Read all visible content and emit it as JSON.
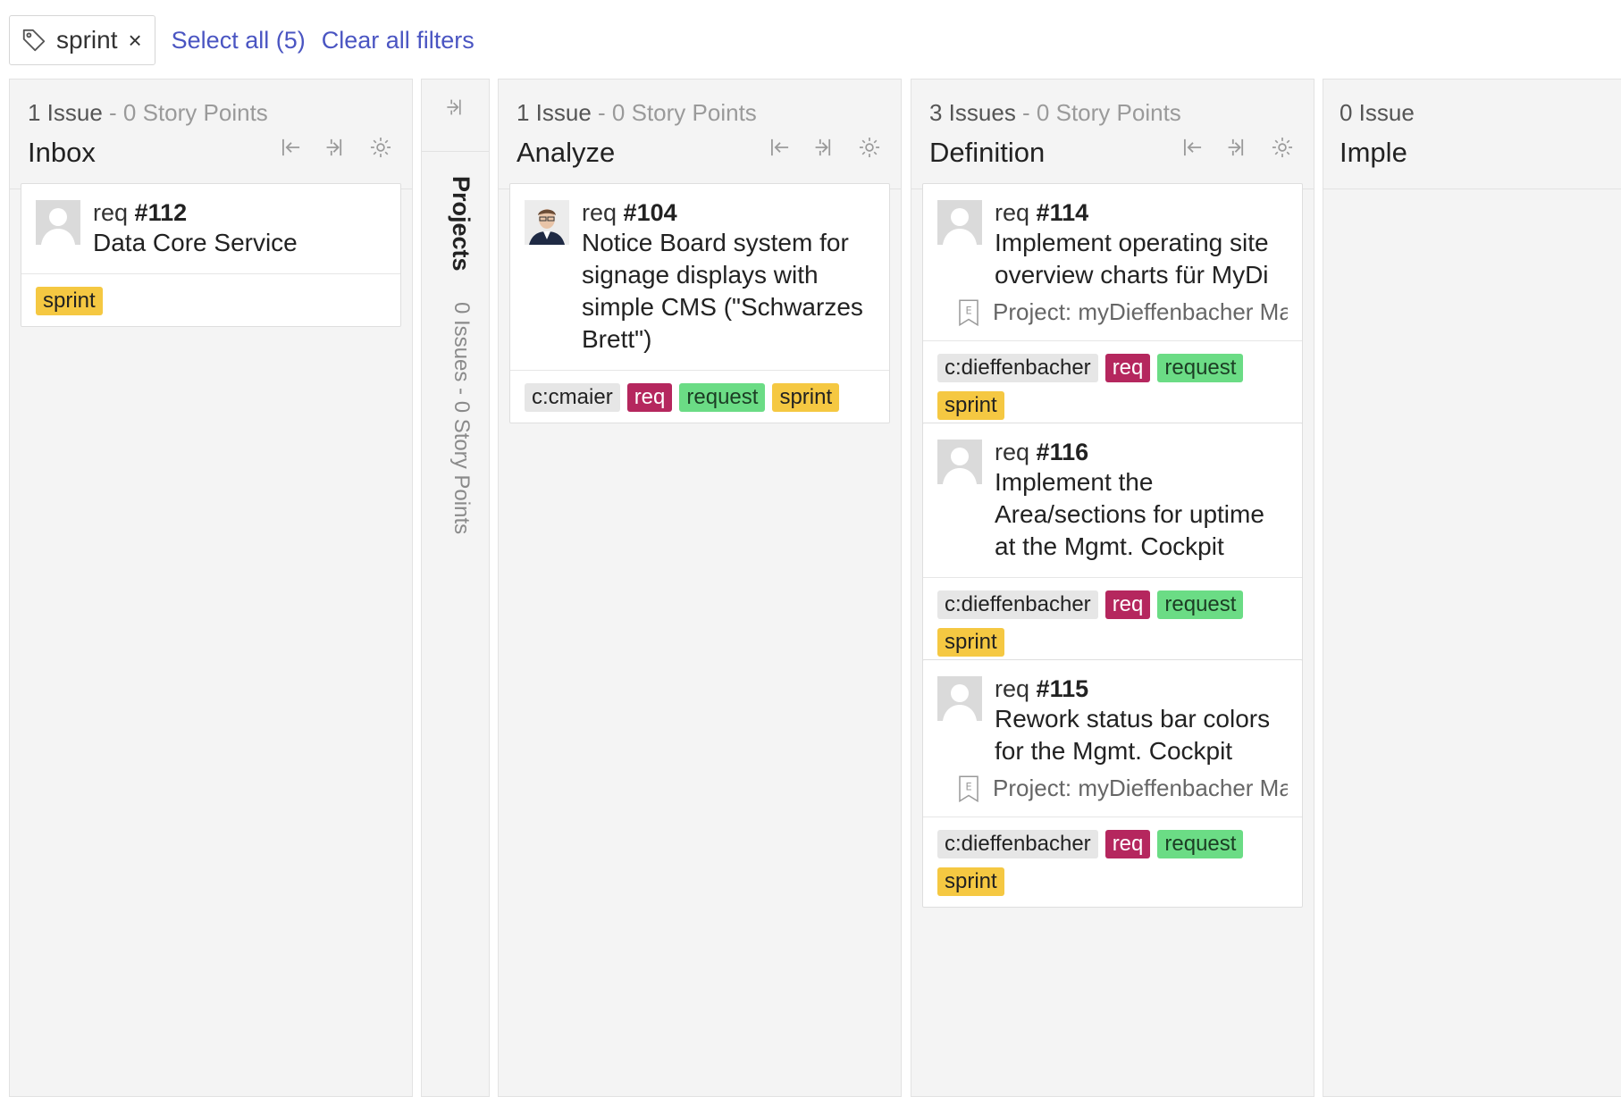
{
  "filter": {
    "chip_label": "sprint",
    "close_glyph": "×",
    "select_all": "Select all (5)",
    "clear_all": "Clear all filters"
  },
  "columns": [
    {
      "count": "1 Issue",
      "points": " - 0 Story Points",
      "title": "Inbox",
      "cards": [
        {
          "type": "req",
          "number": "#112",
          "title": "Data Core Service",
          "labels": [
            "sprint"
          ]
        }
      ]
    },
    {
      "collapsed": true,
      "title": "Projects",
      "summary": "0 Issues - 0 Story Points"
    },
    {
      "count": "1 Issue",
      "points": " - 0 Story Points",
      "title": "Analyze",
      "cards": [
        {
          "type": "req",
          "number": "#104",
          "title": "Notice Board system for signage displays with simple CMS (\"Schwarzes Brett\")",
          "labels": [
            "c:cmaier",
            "req",
            "request",
            "sprint"
          ]
        }
      ]
    },
    {
      "count": "3 Issues",
      "points": " - 0 Story Points",
      "title": "Definition",
      "cards": [
        {
          "type": "req",
          "number": "#114",
          "title": "Implement operating site overview charts für MyDi",
          "project": "Project: myDieffenbacher Mana...",
          "labels": [
            "c:dieffenbacher",
            "req",
            "request",
            "sprint"
          ]
        },
        {
          "type": "req",
          "number": "#116",
          "title": "Implement the Area/sections for uptime at the Mgmt. Cockpit",
          "labels": [
            "c:dieffenbacher",
            "req",
            "request",
            "sprint"
          ]
        },
        {
          "type": "req",
          "number": "#115",
          "title": "Rework status bar colors for the Mgmt. Cockpit",
          "project": "Project: myDieffenbacher Mana...",
          "labels": [
            "c:dieffenbacher",
            "req",
            "request",
            "sprint"
          ]
        }
      ]
    },
    {
      "count": "0 Issue",
      "title": "Imple"
    }
  ],
  "colors": {
    "link": "#4a55c2",
    "sprint": "#f5c842",
    "req": "#b5275e",
    "request": "#6bdc85",
    "client": "#e6e6e6"
  }
}
